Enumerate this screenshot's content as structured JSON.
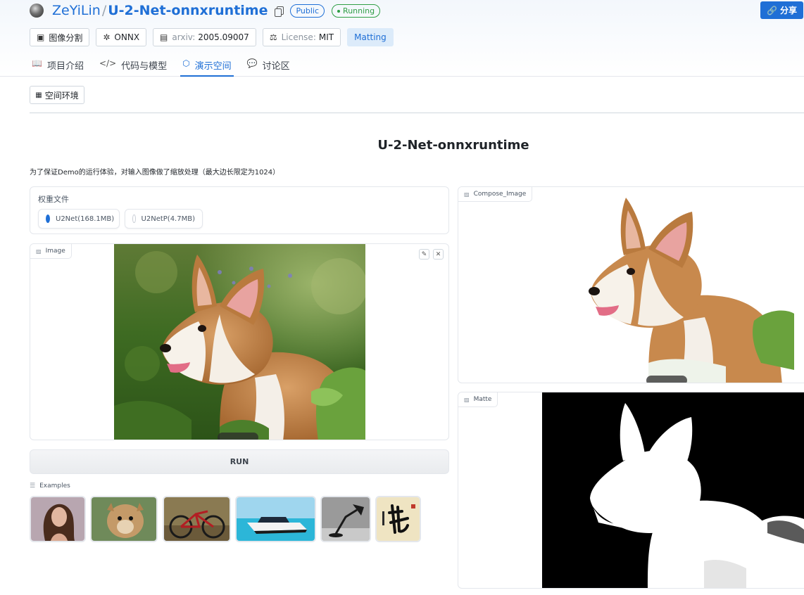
{
  "header": {
    "owner": "ZeYiLin",
    "separator": "/",
    "repo": "U-2-Net-onnxruntime",
    "visibility_badge": "Public",
    "status_badge": "Running",
    "share_label": "分享",
    "tags": {
      "task": "图像分割",
      "framework": "ONNX",
      "arxiv_prefix": "arxiv:",
      "arxiv_id": "2005.09007",
      "license_prefix": "License:",
      "license": "MIT",
      "matting": "Matting"
    },
    "tabs": [
      "项目介绍",
      "代码与模型",
      "演示空间",
      "讨论区"
    ],
    "active_tab": "演示空间"
  },
  "toolbar": {
    "env_label": "空间环境"
  },
  "app": {
    "title": "U-2-Net-onnxruntime",
    "description": "为了保证Demo的运行体验，对输入图像做了缩放处理（最大边长限定为1024）",
    "weights": {
      "label": "权重文件",
      "options": [
        "U2Net(168.1MB)",
        "U2NetP(4.7MB)"
      ],
      "selected": "U2Net(168.1MB)"
    },
    "image_label": "Image",
    "run_label": "RUN",
    "examples_label": "Examples",
    "compose_label": "Compose_Image",
    "matte_label": "Matte"
  },
  "colors": {
    "accent": "#1f6fd6",
    "running": "#2f9e44",
    "border": "#e4e7ec"
  }
}
